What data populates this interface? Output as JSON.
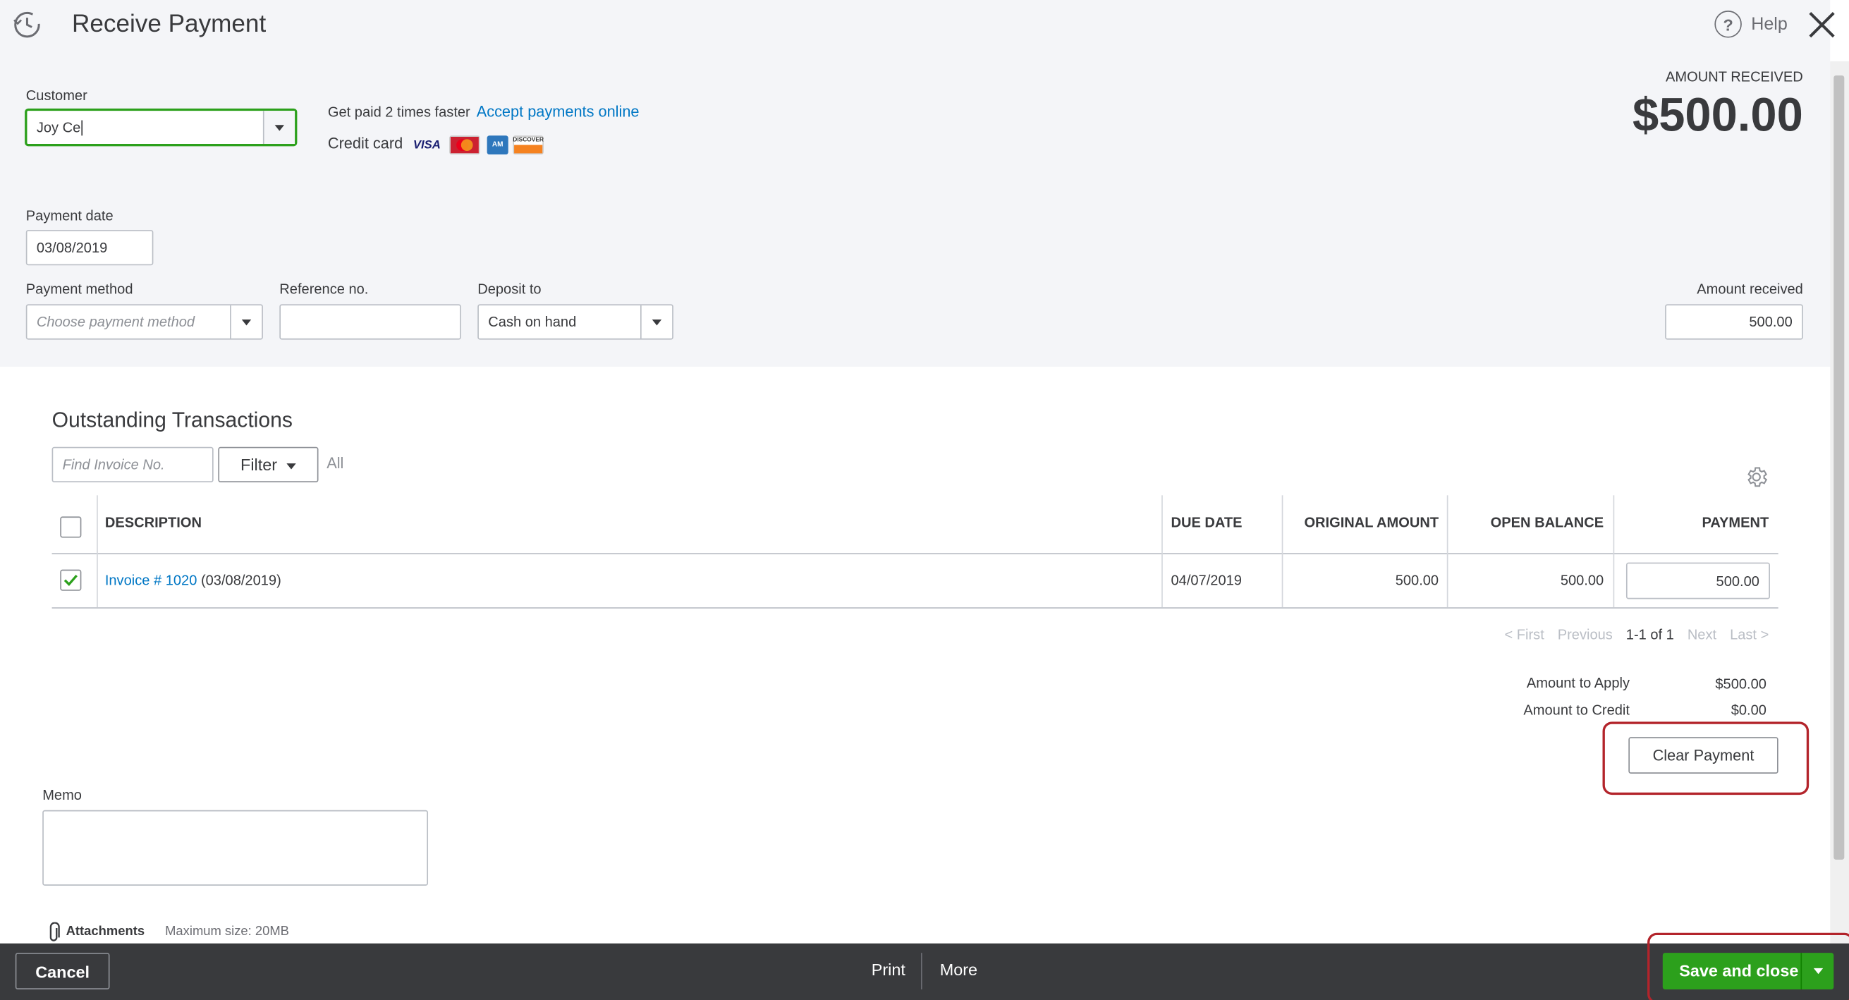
{
  "header": {
    "title": "Receive Payment",
    "help_label": "Help"
  },
  "customer": {
    "label": "Customer",
    "value": "Joy Ce"
  },
  "promo": {
    "text": "Get paid 2 times faster",
    "link": "Accept payments online",
    "credit_card_label": "Credit card",
    "cards": [
      "VISA",
      "MasterCard",
      "AMEX",
      "DISCOVER"
    ]
  },
  "amount_received_header": {
    "label": "AMOUNT RECEIVED",
    "value": "$500.00"
  },
  "payment_date": {
    "label": "Payment date",
    "value": "03/08/2019"
  },
  "payment_method": {
    "label": "Payment method",
    "placeholder": "Choose payment method"
  },
  "reference": {
    "label": "Reference no.",
    "value": ""
  },
  "deposit_to": {
    "label": "Deposit to",
    "value": "Cash on hand"
  },
  "amount_received": {
    "label": "Amount received",
    "value": "500.00"
  },
  "outstanding": {
    "title": "Outstanding Transactions",
    "search_placeholder": "Find Invoice No.",
    "filter_label": "Filter",
    "filter_value": "All",
    "columns": [
      "DESCRIPTION",
      "DUE DATE",
      "ORIGINAL AMOUNT",
      "OPEN BALANCE",
      "PAYMENT"
    ],
    "rows": [
      {
        "checked": true,
        "invoice_link": "Invoice # 1020",
        "invoice_date": "(03/08/2019)",
        "due_date": "04/07/2019",
        "original_amount": "500.00",
        "open_balance": "500.00",
        "payment": "500.00"
      }
    ],
    "pager": {
      "first": "< First",
      "previous": "Previous",
      "range": "1-1 of 1",
      "next": "Next",
      "last": "Last >"
    }
  },
  "totals": {
    "apply_label": "Amount to Apply",
    "apply_value": "$500.00",
    "credit_label": "Amount to Credit",
    "credit_value": "$0.00"
  },
  "clear_payment_label": "Clear Payment",
  "memo": {
    "label": "Memo",
    "value": ""
  },
  "attachments": {
    "label": "Attachments",
    "max_size": "Maximum size: 20MB"
  },
  "footer": {
    "cancel": "Cancel",
    "print": "Print",
    "more": "More",
    "save_close": "Save and close"
  },
  "colors": {
    "brand_green": "#2ca01c",
    "link_blue": "#0077c5",
    "footer_bg": "#393a3d",
    "highlight_red": "#b3242b"
  }
}
